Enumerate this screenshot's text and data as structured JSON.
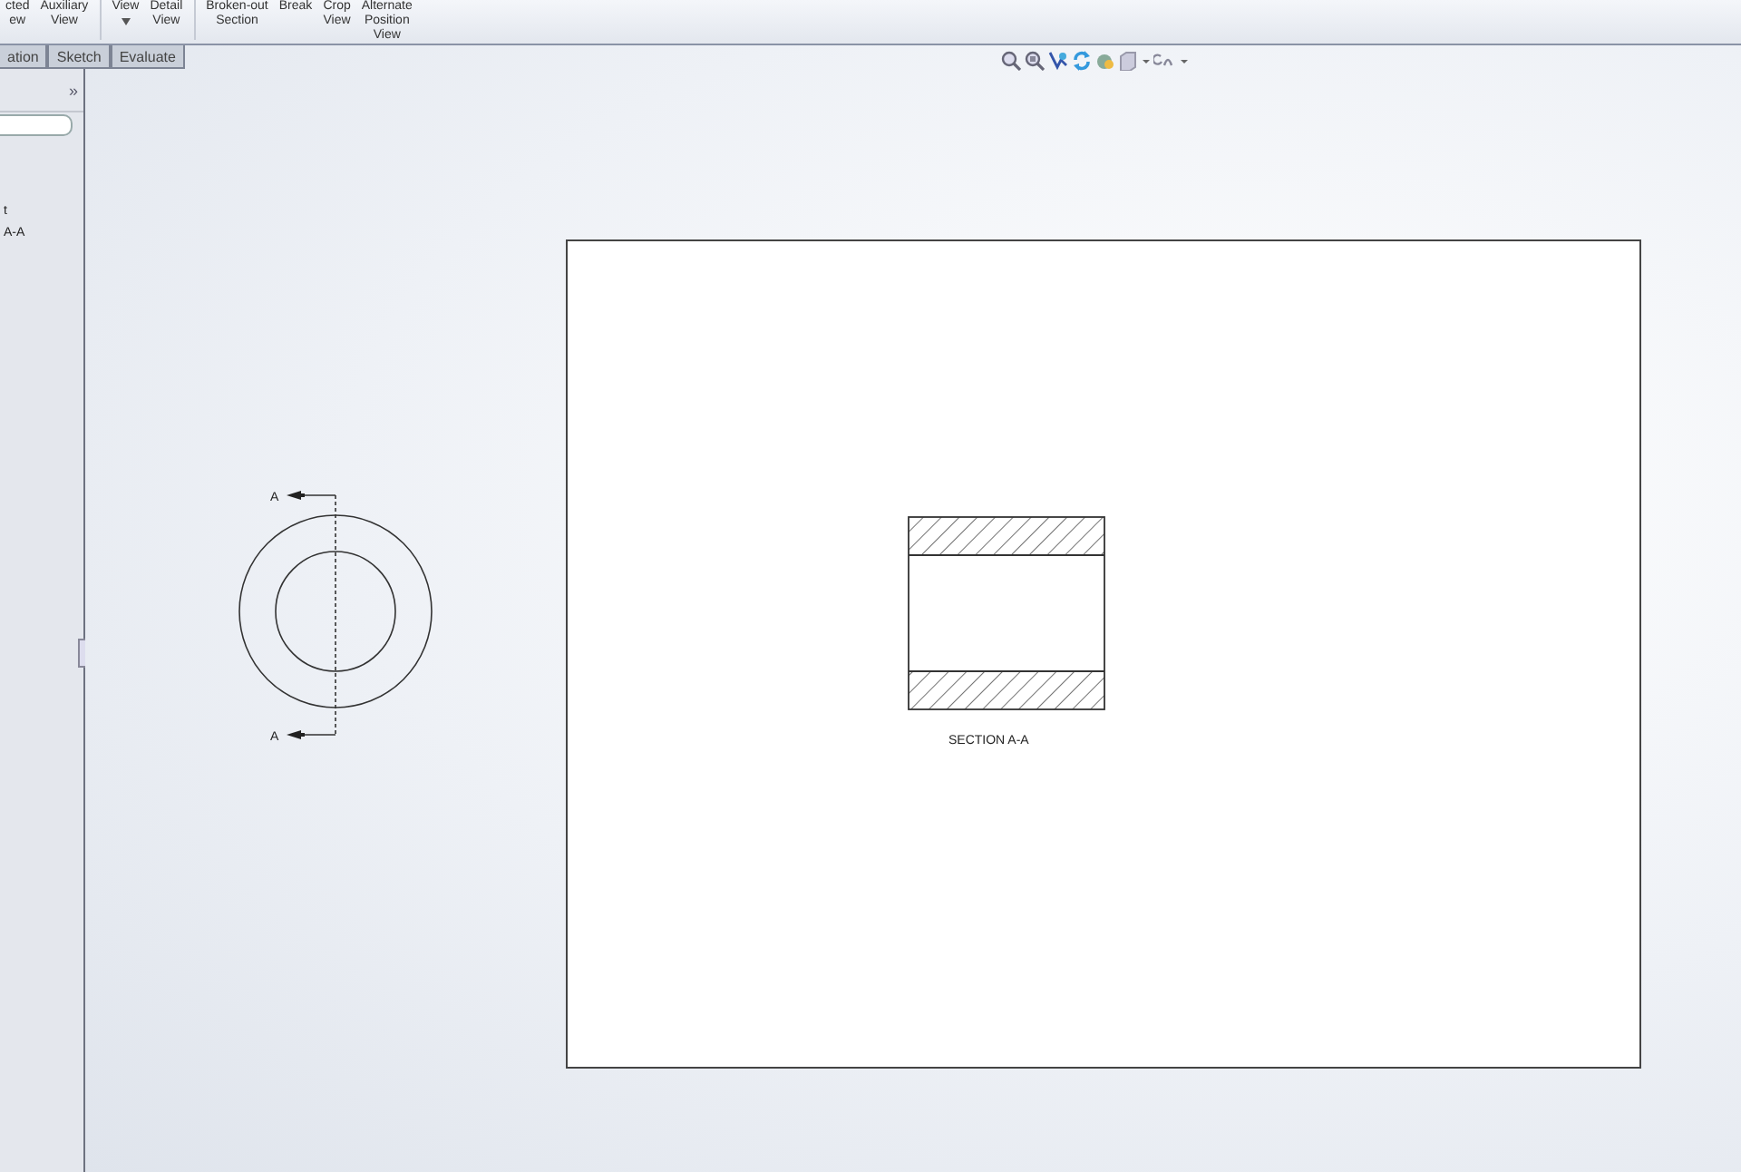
{
  "toolbar": {
    "groups": [
      {
        "buttons": [
          {
            "lines": [
              "cted",
              "ew"
            ],
            "dropdown": false
          },
          {
            "lines": [
              "Auxiliary",
              "View"
            ],
            "dropdown": false
          }
        ]
      },
      {
        "buttons": [
          {
            "lines": [
              "View"
            ],
            "dropdown": true
          },
          {
            "lines": [
              "Detail",
              "View"
            ],
            "dropdown": false
          }
        ]
      },
      {
        "buttons": [
          {
            "lines": [
              "Broken-out",
              "Section"
            ],
            "dropdown": false
          },
          {
            "lines": [
              "Break"
            ],
            "dropdown": false
          },
          {
            "lines": [
              "Crop",
              "View"
            ],
            "dropdown": false
          },
          {
            "lines": [
              "Alternate",
              "Position",
              "View"
            ],
            "dropdown": false
          }
        ]
      }
    ]
  },
  "tabs": [
    {
      "label": "ation"
    },
    {
      "label": "Sketch"
    },
    {
      "label": "Evaluate"
    }
  ],
  "panel": {
    "expand_button": "»",
    "tree": [
      "t",
      "A-A"
    ]
  },
  "drawing": {
    "cut_labels": [
      "A",
      "A"
    ],
    "section_label": "SECTION A-A"
  }
}
